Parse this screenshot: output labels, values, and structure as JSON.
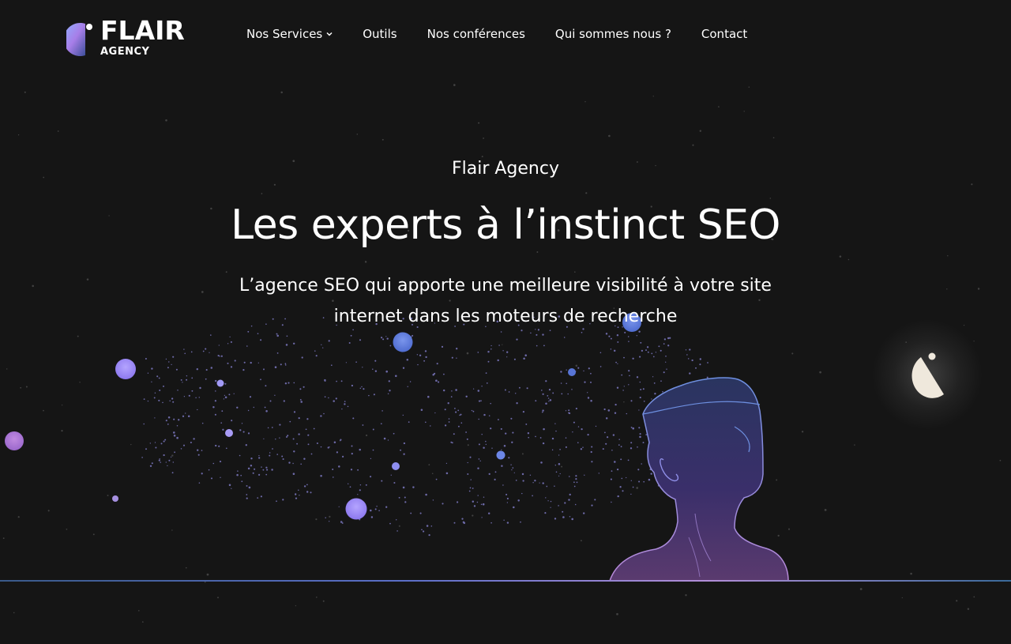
{
  "header": {
    "logo": {
      "name": "FLAIR",
      "sub": "AGENCY"
    },
    "nav": [
      {
        "label": "Nos Services",
        "has_dropdown": true
      },
      {
        "label": "Outils"
      },
      {
        "label": "Nos conférences"
      },
      {
        "label": "Qui sommes nous ?"
      },
      {
        "label": "Contact"
      }
    ]
  },
  "hero": {
    "eyebrow": "Flair Agency",
    "title": "Les experts à l’instinct SEO",
    "lead": "L’agence SEO qui apporte une meilleure visibilité à votre site internet dans les moteurs de recherche"
  },
  "colors": {
    "background": "#151515",
    "text": "#ffffff",
    "accent_purple": "#a58cf0",
    "accent_blue": "#5b7fe0",
    "moon": "#efe8dc"
  },
  "icons": {
    "nav_dropdown": "chevron-down-icon",
    "logo": "flair-logo-mark-icon",
    "moon": "flair-moon-icon"
  }
}
